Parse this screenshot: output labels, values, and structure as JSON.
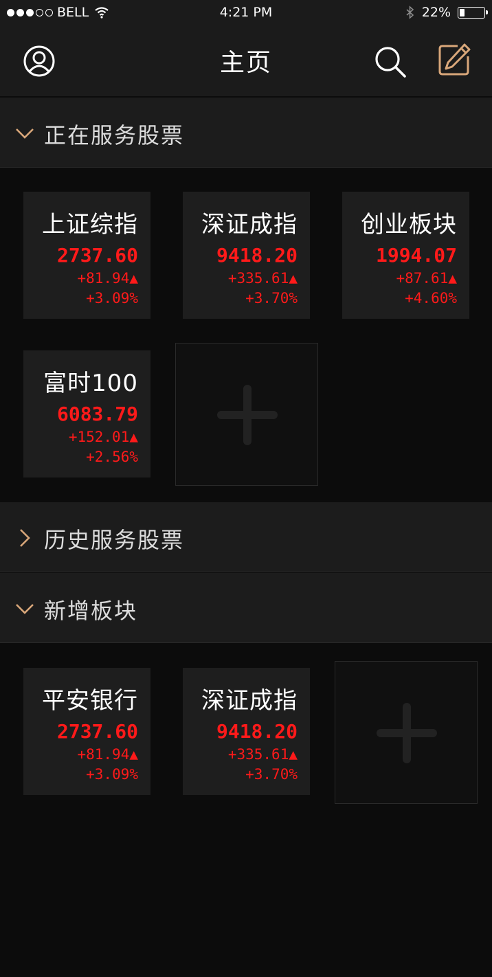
{
  "status_bar": {
    "carrier": "BELL",
    "time": "4:21 PM",
    "battery": "22%",
    "battery_level": 0.22,
    "signal_bars_filled": 3,
    "signal_bars_total": 5
  },
  "nav": {
    "title": "主页",
    "icons": {
      "left": "user-icon",
      "search": "search-icon",
      "edit": "edit-icon"
    },
    "accent_color": "#d9a77a"
  },
  "sections": {
    "current": {
      "label": "正在服务股票",
      "expanded": true
    },
    "history": {
      "label": "历史服务股票",
      "expanded": false
    },
    "new": {
      "label": "新增板块",
      "expanded": true
    }
  },
  "current_stocks": [
    {
      "name": "上证综指",
      "value": "2737.60",
      "change": "+81.94▲",
      "pct": "+3.09%"
    },
    {
      "name": "深证成指",
      "value": "9418.20",
      "change": "+335.61▲",
      "pct": "+3.70%"
    },
    {
      "name": "创业板块",
      "value": "1994.07",
      "change": "+87.61▲",
      "pct": "+4.60%"
    },
    {
      "name": "富时100",
      "value": "6083.79",
      "change": "+152.01▲",
      "pct": "+2.56%"
    }
  ],
  "new_stocks": [
    {
      "name": "平安银行",
      "value": "2737.60",
      "change": "+81.94▲",
      "pct": "+3.09%"
    },
    {
      "name": "深证成指",
      "value": "9418.20",
      "change": "+335.61▲",
      "pct": "+3.70%"
    }
  ],
  "colors": {
    "up": "#ff1a1a",
    "chevron": "#d9a77a"
  }
}
